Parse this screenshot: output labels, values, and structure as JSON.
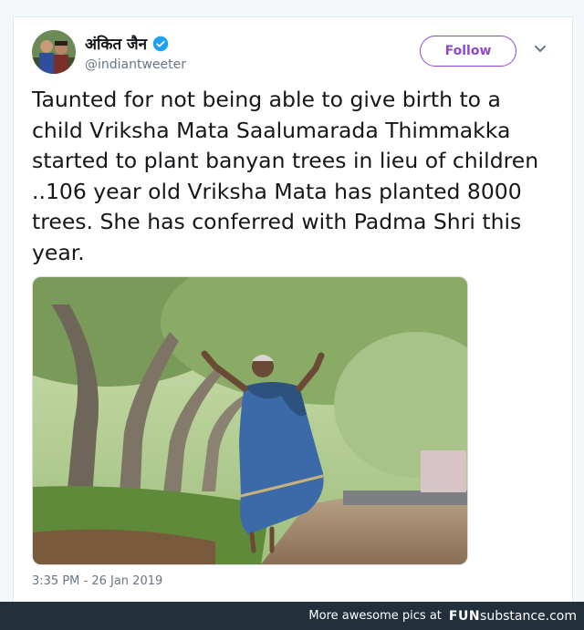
{
  "tweet": {
    "author_name": "अंकित जैन",
    "author_handle": "@indiantweeter",
    "follow_label": "Follow",
    "text": "Taunted for not being able to give birth to a child Vriksha Mata Saalumarada Thimmakka started to plant banyan trees in lieu of children ..106 year old Vriksha Mata has planted 8000 trees. She has conferred with Padma Shri this year.",
    "timestamp": "3:35 PM - 26 Jan 2019"
  },
  "icons": {
    "verified": "verified-badge-icon",
    "more": "chevron-down-icon"
  },
  "colors": {
    "follow_accent": "#8c49d0",
    "verified_blue": "#1da1f2",
    "footer_bg": "#22303c"
  },
  "footer": {
    "promo_text": "More awesome pics at",
    "brand_bold": "FUN",
    "brand_rest": "substance.com"
  }
}
